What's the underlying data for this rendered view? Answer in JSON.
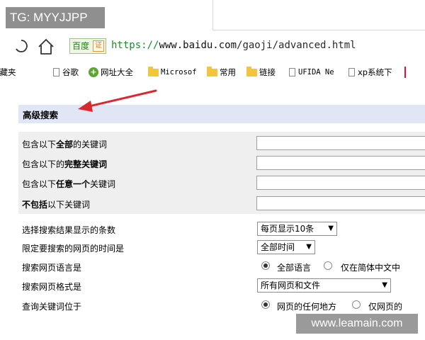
{
  "watermark_top": "TG: MYYJJPP",
  "watermark_bottom": "www.leamain.com",
  "browser": {
    "site_badge": "百度",
    "badge_mark": "证",
    "url_scheme": "https://",
    "url_host": "www.baidu.com",
    "url_path": "/gaoji/advanced.html"
  },
  "bookmarks": [
    {
      "label": "收藏夹",
      "icon": "none"
    },
    {
      "label": "谷歌",
      "icon": "page-icon"
    },
    {
      "label": "网址大全",
      "icon": "globe-icon"
    },
    {
      "label": "Microsof",
      "icon": "folder-icon"
    },
    {
      "label": "常用",
      "icon": "folder-icon"
    },
    {
      "label": "链接",
      "icon": "folder-icon"
    },
    {
      "label": "UFIDA Ne",
      "icon": "page-icon"
    },
    {
      "label": "xp系统下",
      "icon": "page-icon"
    }
  ],
  "section_title": "高级搜索",
  "keyword_rows": [
    {
      "pre": "包含以下",
      "bold": "全部",
      "post": "的关键词",
      "value": ""
    },
    {
      "pre": "包含以下的",
      "bold": "完整关键词",
      "post": "",
      "value": ""
    },
    {
      "pre": "包含以下",
      "bold": "任意一个",
      "post": "关键词",
      "value": ""
    },
    {
      "pre": "",
      "bold": "不包括",
      "post": "以下关键词",
      "value": ""
    }
  ],
  "options": {
    "results_label": "选择搜索结果显示的条数",
    "results_value": "每页显示10条",
    "time_label": "限定要搜索的网页的时间是",
    "time_value": "全部时间",
    "lang_label": "搜索网页语言是",
    "lang_opt1": "全部语言",
    "lang_opt2": "仅在简体中文中",
    "format_label": "搜索网页格式是",
    "format_value": "所有网页和文件",
    "position_label": "查询关键词位于",
    "position_opt1": "网页的任何地方",
    "position_opt2": "仅网页的"
  },
  "annotation_color": "#d9282f"
}
